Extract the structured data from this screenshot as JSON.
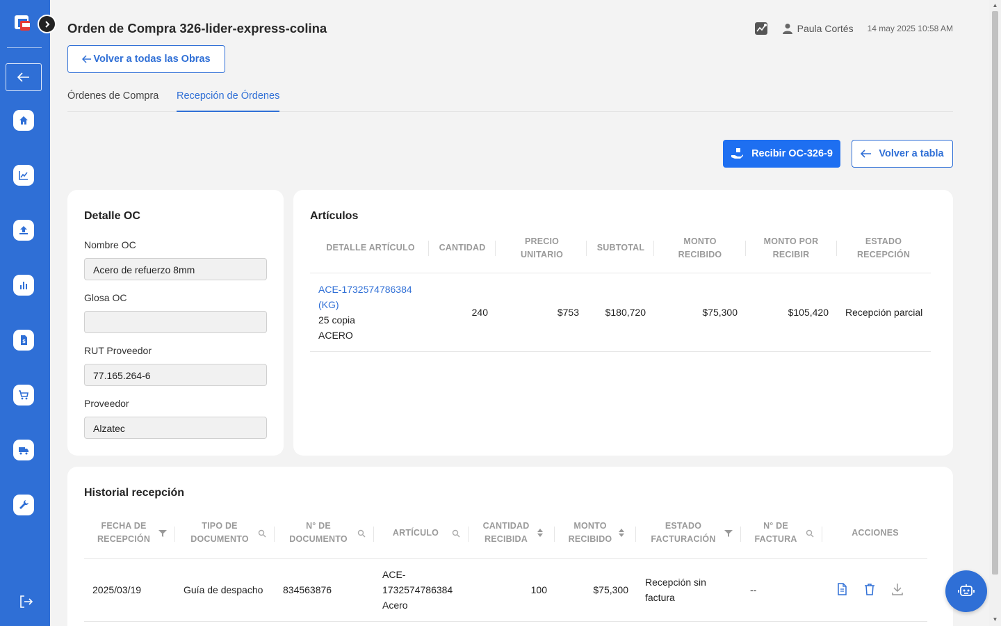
{
  "header": {
    "title": "Orden de Compra 326-lider-express-colina",
    "user_name": "Paula Cortés",
    "timestamp": "14 may 2025 10:58 AM",
    "back_obras_label": "Volver a todas las Obras"
  },
  "tabs": [
    {
      "label": "Órdenes de Compra",
      "active": false
    },
    {
      "label": "Recepción de Órdenes",
      "active": true
    }
  ],
  "actions": {
    "recibir_label": "Recibir OC-326-9",
    "volver_tabla_label": "Volver a tabla"
  },
  "detalle": {
    "title": "Detalle OC",
    "fields": [
      {
        "label": "Nombre OC",
        "value": "Acero de refuerzo 8mm"
      },
      {
        "label": "Glosa OC",
        "value": ""
      },
      {
        "label": "RUT Proveedor",
        "value": "77.165.264-6"
      },
      {
        "label": "Proveedor",
        "value": "Alzatec"
      }
    ]
  },
  "articulos": {
    "title": "Artículos",
    "headers": [
      "DETALLE ARTÍCULO",
      "CANTIDAD",
      "PRECIO UNITARIO",
      "SUBTOTAL",
      "MONTO RECIBIDO",
      "MONTO POR RECIBIR",
      "ESTADO RECEPCIÓN"
    ],
    "rows": [
      {
        "code": "ACE-1732574786384 (KG)",
        "line2": "25 copia",
        "line3": "ACERO",
        "cantidad": "240",
        "precio": "$753",
        "subtotal": "$180,720",
        "recibido": "$75,300",
        "por_recibir": "$105,420",
        "estado": "Recepción parcial"
      }
    ]
  },
  "historial": {
    "title": "Historial recepción",
    "headers": [
      "FECHA DE RECEPCIÓN",
      "TIPO DE DOCUMENTO",
      "N° DE DOCUMENTO",
      "ARTÍCULO",
      "CANTIDAD RECIBIDA",
      "MONTO RECIBIDO",
      "ESTADO FACTURACIÓN",
      "N° DE FACTURA",
      "ACCIONES"
    ],
    "rows": [
      {
        "fecha": "2025/03/19",
        "tipo": "Guía de despacho",
        "numero": "834563876",
        "articulo_1": "ACE-",
        "articulo_2": "1732574786384",
        "articulo_3": "Acero",
        "cantidad": "100",
        "monto": "$75,300",
        "estado_1": "Recepción sin",
        "estado_2": "factura",
        "factura": "--"
      }
    ]
  },
  "icons": {
    "sidebar": [
      "home-icon",
      "chart-line-icon",
      "upload-icon",
      "bar-chart-icon",
      "invoice-icon",
      "cart-icon",
      "truck-icon",
      "wrench-icon"
    ],
    "fab": "robot-icon"
  },
  "colors": {
    "sidebar": "#2f6fd6",
    "accent": "#1e6ff1",
    "background": "#f3f3f3"
  }
}
